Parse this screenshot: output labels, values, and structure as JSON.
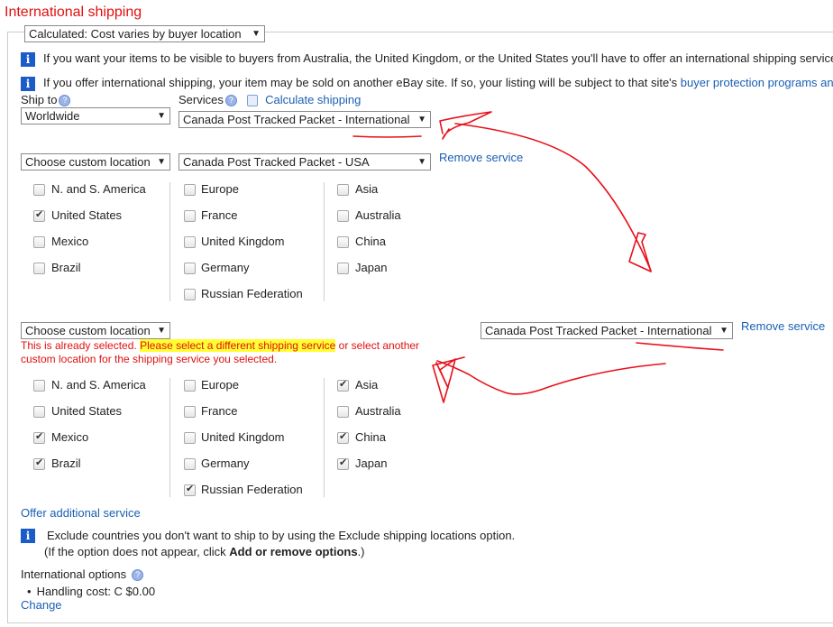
{
  "section_title": "International shipping",
  "cost_type": "Calculated: Cost varies by buyer location",
  "info_line_1": "If you want your items to be visible to buyers from Australia, the United Kingdom, or the United States you'll have to offer an international shipping service",
  "info_line_2_pre": "If you offer international shipping, your item may be sold on another eBay site. If so, your listing will be subject to that site's",
  "info_line_2_link": "buyer protection programs and",
  "ship_to_label": "Ship to",
  "services_label": "Services",
  "calculate_shipping": "Calculate shipping",
  "help_glyph": "?",
  "info_glyph": "i",
  "arrow_glyph": "▼",
  "service1": {
    "ship_to": "Worldwide",
    "service": "Canada Post Tracked Packet - International"
  },
  "service2": {
    "location": "Choose custom location",
    "service": "Canada Post Tracked Packet - USA",
    "remove": "Remove service",
    "col1": [
      {
        "label": "N. and S. America",
        "checked": false
      },
      {
        "label": "United States",
        "checked": true
      },
      {
        "label": "Mexico",
        "checked": false
      },
      {
        "label": "Brazil",
        "checked": false
      }
    ],
    "col2": [
      {
        "label": "Europe",
        "checked": false
      },
      {
        "label": "France",
        "checked": false
      },
      {
        "label": "United Kingdom",
        "checked": false
      },
      {
        "label": "Germany",
        "checked": false
      },
      {
        "label": "Russian Federation",
        "checked": false
      }
    ],
    "col3": [
      {
        "label": "Asia",
        "checked": false
      },
      {
        "label": "Australia",
        "checked": false
      },
      {
        "label": "China",
        "checked": false
      },
      {
        "label": "Japan",
        "checked": false
      }
    ]
  },
  "service3": {
    "location": "Choose custom location",
    "service": "Canada Post Tracked Packet - International",
    "remove": "Remove service",
    "error_pre": "This is already selected.",
    "error_highlight": "Please select a different shipping service",
    "error_post_1": "or select another",
    "error_line_2": "custom location for the shipping service you selected.",
    "col1": [
      {
        "label": "N. and S. America",
        "checked": false
      },
      {
        "label": "United States",
        "checked": false
      },
      {
        "label": "Mexico",
        "checked": true
      },
      {
        "label": "Brazil",
        "checked": true
      }
    ],
    "col2": [
      {
        "label": "Europe",
        "checked": false
      },
      {
        "label": "France",
        "checked": false
      },
      {
        "label": "United Kingdom",
        "checked": false
      },
      {
        "label": "Germany",
        "checked": false
      },
      {
        "label": "Russian Federation",
        "checked": true
      }
    ],
    "col3": [
      {
        "label": "Asia",
        "checked": true
      },
      {
        "label": "Australia",
        "checked": false
      },
      {
        "label": "China",
        "checked": true
      },
      {
        "label": "Japan",
        "checked": true
      }
    ]
  },
  "offer_additional": "Offer additional service",
  "exclude_line_1": "Exclude countries you don't want to ship to by using the Exclude shipping locations option.",
  "exclude_line_2_pre": "(If the option does not appear, click",
  "exclude_line_2_bold": "Add or remove options",
  "exclude_line_2_post": ".)",
  "intl_options_label": "International options",
  "handling_cost": "Handling cost: C $0.00",
  "change_link": "Change",
  "colors": {
    "title_red": "#e01010",
    "link_blue": "#1a5fb4",
    "info_blue": "#1c5cc8",
    "highlight": "#ffff33",
    "annotation_red": "#e8101a"
  }
}
